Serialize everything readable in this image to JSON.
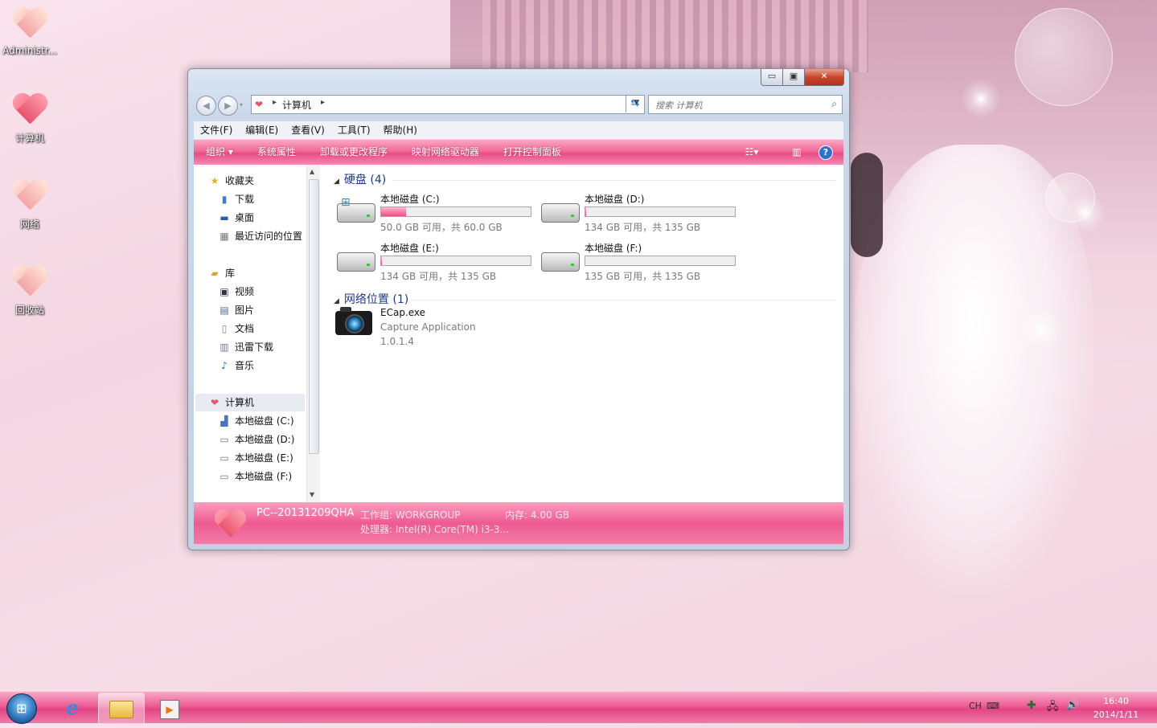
{
  "desktop": {
    "icons": [
      {
        "label": "Administr..."
      },
      {
        "label": "计算机"
      },
      {
        "label": "网络"
      },
      {
        "label": "回收站"
      }
    ]
  },
  "window": {
    "controls": {
      "minimize": "▭",
      "maximize": "▣",
      "close": "✕"
    },
    "address": {
      "location": "计算机"
    },
    "search": {
      "placeholder": "搜索 计算机"
    },
    "menu": [
      "文件(F)",
      "编辑(E)",
      "查看(V)",
      "工具(T)",
      "帮助(H)"
    ],
    "toolbar": {
      "organize": "组织 ▾",
      "items": [
        "系统属性",
        "卸载或更改程序",
        "映射网络驱动器",
        "打开控制面板"
      ]
    },
    "nav": {
      "favorites": {
        "label": "收藏夹",
        "items": [
          "下载",
          "桌面",
          "最近访问的位置"
        ]
      },
      "libraries": {
        "label": "库",
        "items": [
          "视频",
          "图片",
          "文档",
          "迅雷下载",
          "音乐"
        ]
      },
      "computer": {
        "label": "计算机",
        "items": [
          "本地磁盘 (C:)",
          "本地磁盘 (D:)",
          "本地磁盘 (E:)",
          "本地磁盘 (F:)"
        ]
      }
    },
    "groups": {
      "drives_label": "硬盘 (4)",
      "network_label": "网络位置 (1)"
    },
    "drives": [
      {
        "name": "本地磁盘 (C:)",
        "free": "50.0 GB 可用，共 60.0 GB",
        "used_fraction": 0.167
      },
      {
        "name": "本地磁盘 (D:)",
        "free": "134 GB 可用，共 135 GB",
        "used_fraction": 0.007
      },
      {
        "name": "本地磁盘 (E:)",
        "free": "134 GB 可用，共 135 GB",
        "used_fraction": 0.007
      },
      {
        "name": "本地磁盘 (F:)",
        "free": "135 GB 可用，共 135 GB",
        "used_fraction": 0.0
      }
    ],
    "network_item": {
      "name": "ECap.exe",
      "description": "Capture Application",
      "version": "1.0.1.4"
    },
    "details": {
      "pc_name": "PC--20131209QHA",
      "workgroup_label": "工作组:",
      "workgroup": "WORKGROUP",
      "memory_label": "内存:",
      "memory": "4.00 GB",
      "cpu_label": "处理器:",
      "cpu": "Intel(R) Core(TM) i3-3..."
    }
  },
  "taskbar": {
    "tray": {
      "lang": "CH"
    },
    "clock": {
      "time": "16:40",
      "date": "2014/1/11"
    }
  },
  "colors": {
    "accent_pink": "#e84d84",
    "link_blue": "#1e3a8c"
  }
}
